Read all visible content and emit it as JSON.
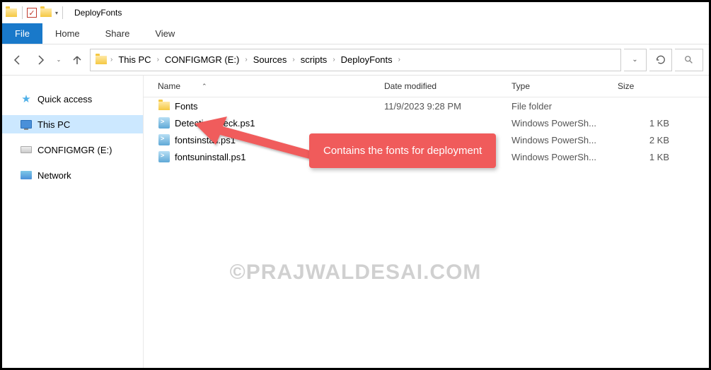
{
  "titlebar": {
    "title": "DeployFonts"
  },
  "ribbon": {
    "file": "File",
    "tabs": [
      "Home",
      "Share",
      "View"
    ]
  },
  "breadcrumb": [
    "This PC",
    "CONFIGMGR (E:)",
    "Sources",
    "scripts",
    "DeployFonts"
  ],
  "sidebar": {
    "items": [
      {
        "label": "Quick access"
      },
      {
        "label": "This PC"
      },
      {
        "label": "CONFIGMGR (E:)"
      },
      {
        "label": "Network"
      }
    ]
  },
  "columns": {
    "name": "Name",
    "date": "Date modified",
    "type": "Type",
    "size": "Size"
  },
  "files": [
    {
      "name": "Fonts",
      "date": "11/9/2023 9:28 PM",
      "type": "File folder",
      "size": ""
    },
    {
      "name": "Detectioncheck.ps1",
      "date": "",
      "type": "Windows PowerSh...",
      "size": "1 KB"
    },
    {
      "name": "fontsinstall.ps1",
      "date": "",
      "type": "Windows PowerSh...",
      "size": "2 KB"
    },
    {
      "name": "fontsuninstall.ps1",
      "date": "",
      "type": "Windows PowerSh...",
      "size": "1 KB"
    }
  ],
  "callout": "Contains the fonts for deployment",
  "watermark": "©PRAJWALDESAI.COM"
}
